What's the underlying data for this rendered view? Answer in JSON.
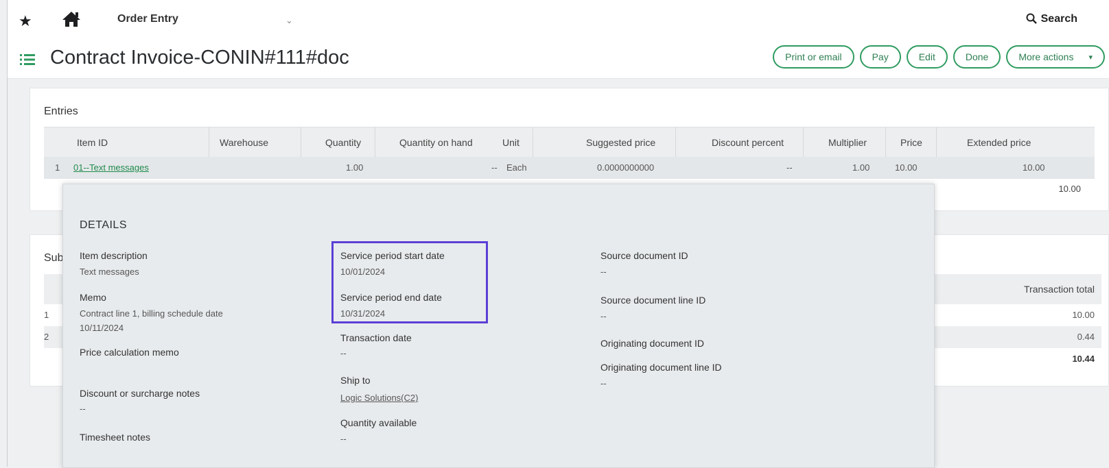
{
  "topbar": {
    "module": "Order Entry",
    "search_label": "Search"
  },
  "title": "Contract Invoice-CONIN#111#doc",
  "actions": [
    "Print or email",
    "Pay",
    "Edit",
    "Done",
    "More actions"
  ],
  "entries": {
    "label": "Entries",
    "columns": [
      "Item ID",
      "Warehouse",
      "Quantity",
      "Quantity on hand",
      "Unit",
      "Suggested price",
      "Discount percent",
      "Multiplier",
      "Price",
      "Extended price"
    ],
    "rows": [
      {
        "num": "1",
        "item_id": "01--Text messages",
        "warehouse": "",
        "quantity": "1.00",
        "qty_on_hand": "--",
        "unit": "Each",
        "suggested_price": "0.0000000000",
        "discount_percent": "--",
        "multiplier": "1.00",
        "price": "10.00",
        "extended_price": "10.00"
      }
    ],
    "total": "10.00"
  },
  "subtotals": {
    "label": "Subt",
    "column": "Transaction total",
    "rows": [
      {
        "num": "1",
        "value": "10.00"
      },
      {
        "num": "2",
        "value": "0.44"
      },
      {
        "num": "",
        "value": "10.44"
      }
    ]
  },
  "details": {
    "title": "DETAILS",
    "col1": {
      "item_description_label": "Item description",
      "item_description": "Text messages",
      "memo_label": "Memo",
      "memo_line1": "Contract line 1, billing schedule date",
      "memo_line2": "10/11/2024",
      "price_calc_label": "Price calculation memo",
      "discount_notes_label": "Discount or surcharge notes",
      "discount_notes": "--",
      "timesheet_notes_label": "Timesheet notes"
    },
    "col2": {
      "start_label": "Service period start date",
      "start_value": "10/01/2024",
      "end_label": "Service period end date",
      "end_value": "10/31/2024",
      "txn_date_label": "Transaction date",
      "txn_date": "--",
      "ship_to_label": "Ship to",
      "ship_to": "Logic Solutions(C2)",
      "qty_avail_label": "Quantity available",
      "qty_avail": "--"
    },
    "col3": {
      "source_doc_label": "Source document ID",
      "source_doc": "--",
      "source_line_label": "Source document line ID",
      "source_line": "--",
      "orig_doc_label": "Originating document ID",
      "orig_line_label": "Originating document line ID",
      "orig_line": "--"
    }
  },
  "colors": {
    "accent": "#2e9b5f",
    "highlight": "#5b3fd6"
  }
}
